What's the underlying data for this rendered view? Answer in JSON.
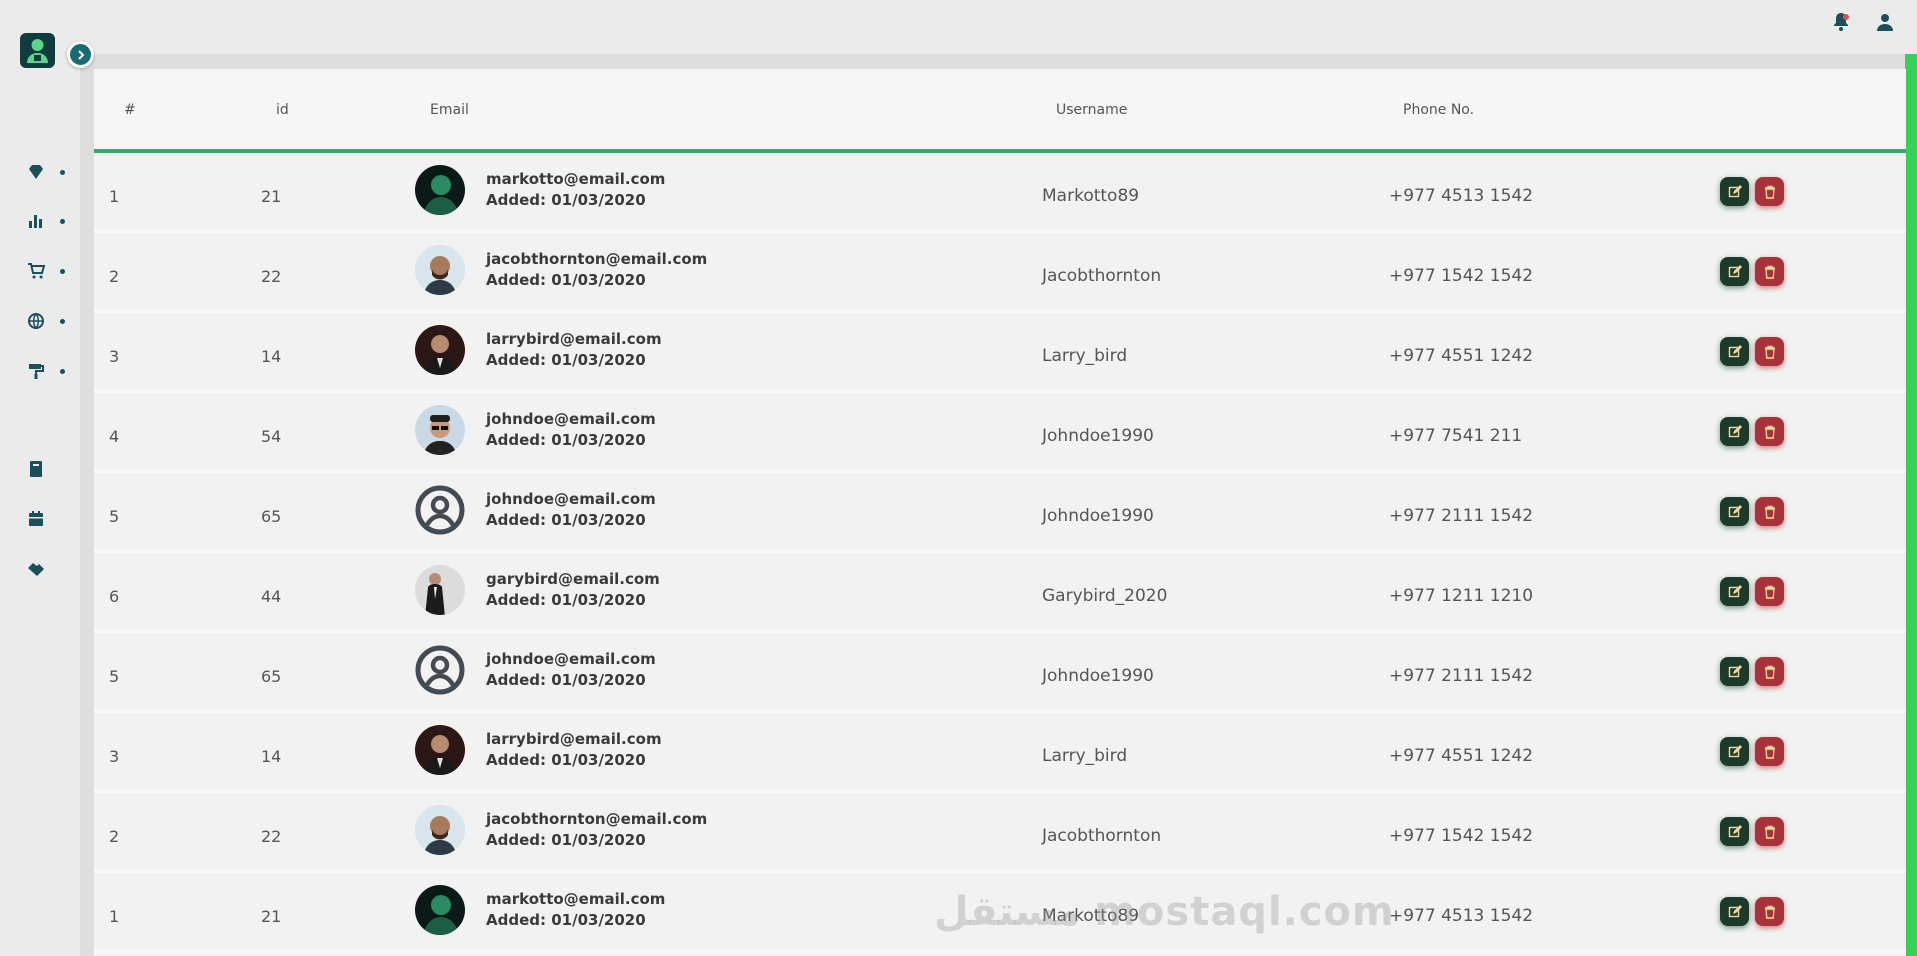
{
  "table": {
    "headers": [
      "#",
      "id",
      "Email",
      "Username",
      "Phone No."
    ],
    "rows": [
      {
        "num": "1",
        "id": "21",
        "email": "markotto@email.com",
        "added": "Added: 01/03/2020",
        "username": "Markotto89",
        "phone": "+977 4513 1542",
        "avatar": "photo-green"
      },
      {
        "num": "2",
        "id": "22",
        "email": "jacobthornton@email.com",
        "added": "Added: 01/03/2020",
        "username": "Jacobthornton",
        "phone": "+977 1542 1542",
        "avatar": "photo-beard"
      },
      {
        "num": "3",
        "id": "14",
        "email": "larrybird@email.com",
        "added": "Added: 01/03/2020",
        "username": "Larry_bird",
        "phone": "+977 4551 1242",
        "avatar": "photo-suit"
      },
      {
        "num": "4",
        "id": "54",
        "email": "johndoe@email.com",
        "added": "Added: 01/03/2020",
        "username": "Johndoe1990",
        "phone": "+977 7541 211",
        "avatar": "photo-glasses"
      },
      {
        "num": "5",
        "id": "65",
        "email": "johndoe@email.com",
        "added": "Added: 01/03/2020",
        "username": "Johndoe1990",
        "phone": "+977 2111 1542",
        "avatar": "default-user-icon"
      },
      {
        "num": "6",
        "id": "44",
        "email": "garybird@email.com",
        "added": "Added: 01/03/2020",
        "username": "Garybird_2020",
        "phone": "+977 1211 1210",
        "avatar": "photo-standing"
      },
      {
        "num": "5",
        "id": "65",
        "email": "johndoe@email.com",
        "added": "Added: 01/03/2020",
        "username": "Johndoe1990",
        "phone": "+977 2111 1542",
        "avatar": "default-user-icon"
      },
      {
        "num": "3",
        "id": "14",
        "email": "larrybird@email.com",
        "added": "Added: 01/03/2020",
        "username": "Larry_bird",
        "phone": "+977 4551 1242",
        "avatar": "photo-suit"
      },
      {
        "num": "2",
        "id": "22",
        "email": "jacobthornton@email.com",
        "added": "Added: 01/03/2020",
        "username": "Jacobthornton",
        "phone": "+977 1542 1542",
        "avatar": "photo-beard"
      },
      {
        "num": "1",
        "id": "21",
        "email": "markotto@email.com",
        "added": "Added: 01/03/2020",
        "username": "Markotto89",
        "phone": "+977 4513 1542",
        "avatar": "photo-green"
      }
    ]
  },
  "sidebar": {
    "items": [
      "diamond-icon",
      "bar-chart-icon",
      "cart-icon",
      "globe-icon",
      "paint-roller-icon",
      "book-icon",
      "calendar-icon",
      "handshake-icon"
    ]
  },
  "topbar": {
    "icons": [
      "bell-icon",
      "user-icon"
    ]
  },
  "watermark": "مستقل mostaql.com",
  "colors": {
    "accent": "#3aa76d",
    "sidebar_icon": "#1b4f5a",
    "edit": "#1e3a2a",
    "delete": "#a8323a"
  }
}
